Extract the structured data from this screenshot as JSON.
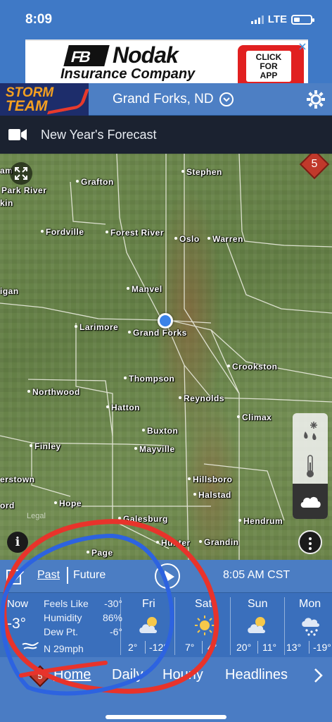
{
  "status_bar": {
    "time": "8:09",
    "network": "LTE"
  },
  "ad": {
    "logo_mark": "FB",
    "brand": "Nodak",
    "sub": "Insurance Company",
    "cta_lines": [
      "CLICK",
      "FOR",
      "APP"
    ]
  },
  "header": {
    "logo_line1": "STORM",
    "logo_line2": "TEAM",
    "location": "Grand Forks, ND"
  },
  "video": {
    "title": "New Year's Forecast"
  },
  "map": {
    "alert_count": "5",
    "legal": "Legal",
    "towns": [
      "Stephen",
      "Grafton",
      "Park River",
      "kin",
      "Fordville",
      "Forest River",
      "Oslo",
      "Warren",
      "Manvel",
      "igan",
      "Larimore",
      "Grand Forks",
      "Crookston",
      "Thompson",
      "Northwood",
      "Reynolds",
      "Hatton",
      "Climax",
      "Buxton",
      "Finley",
      "Mayville",
      "erstown",
      "Hillsboro",
      "Halstad",
      "ord",
      "Hope",
      "Galesburg",
      "Hendrum",
      "Page",
      "Hunter",
      "Grandin",
      "am"
    ]
  },
  "playback": {
    "past": "Past",
    "future": "Future",
    "timestamp": "8:05 AM CST"
  },
  "current": {
    "label": "Now",
    "temp": "-3°",
    "feels_like_label": "Feels Like",
    "feels_like": "-30°",
    "humidity_label": "Humidity",
    "humidity": "86%",
    "dew_label": "Dew Pt.",
    "dew": "-6°",
    "wind": "N 29mph"
  },
  "days": [
    {
      "name": "Fri",
      "hi": "2°",
      "lo": "-12°",
      "icon": "partly-cloudy-icon"
    },
    {
      "name": "Sat",
      "hi": "7°",
      "lo": "4°",
      "icon": "sunny-icon"
    },
    {
      "name": "Sun",
      "hi": "20°",
      "lo": "11°",
      "icon": "partly-cloudy-icon"
    },
    {
      "name": "Mon",
      "hi": "13°",
      "lo": "-19°",
      "icon": "snow-icon"
    }
  ],
  "nav": {
    "alert_count": "5",
    "items": [
      "Home",
      "Daily",
      "Hourly",
      "Headlines"
    ]
  },
  "colors": {
    "primary_blue": "#3f79c6",
    "alert_red": "#c0392b",
    "annotation_red": "#e8332b",
    "annotation_blue": "#2d63e0"
  }
}
